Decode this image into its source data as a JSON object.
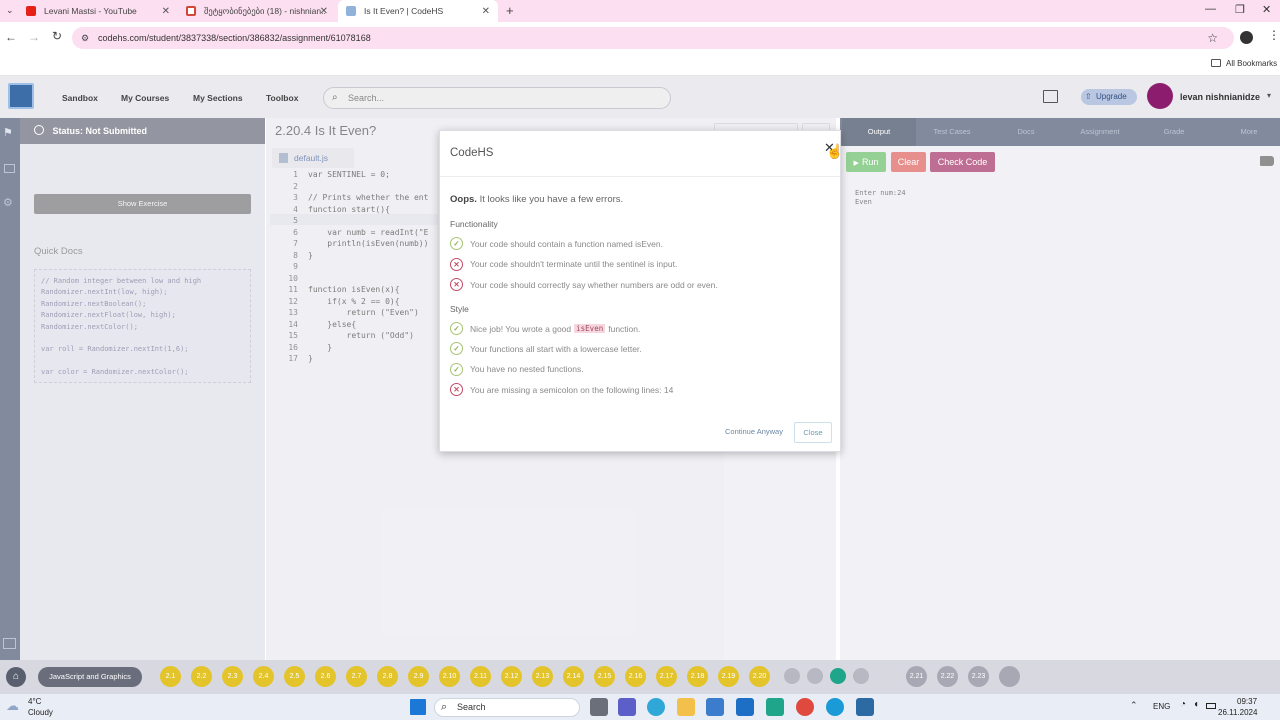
{
  "browser": {
    "tabs": [
      {
        "label": "Levani Mastsi - YouTube",
        "icon": "youtube-icon"
      },
      {
        "label": "შეტყობინებები (18) - nishnian...",
        "icon": "gmail-icon"
      },
      {
        "label": "Is It Even? | CodeHS",
        "icon": "codehs-icon"
      }
    ],
    "url": "codehs.com/student/3837338/section/386832/assignment/61078168",
    "bookmarks_label": "All Bookmarks"
  },
  "nav": {
    "links": [
      "Sandbox",
      "My Courses",
      "My Sections",
      "Toolbox"
    ],
    "search_placeholder": "Search...",
    "upgrade_label": "Upgrade",
    "user_name": "levan nishnianidze"
  },
  "left": {
    "status": "Status: Not Submitted",
    "show_exercise": "Show Exercise",
    "quick_docs_title": "Quick Docs",
    "quick_docs_code": "// Random integer between low and high\nRandomizer.nextInt(low, high);\nRandomizer.nextBoolean();\nRandomizer.nextFloat(low, high);\nRandomizer.nextColor();\n\nvar roll = Randomizer.nextInt(1,6);\n\nvar color = Randomizer.nextColor();"
  },
  "editor": {
    "title": "2.20.4 Is It Even?",
    "file_tab": "default.js",
    "lines": [
      "var SENTINEL = 0;",
      "",
      "// Prints whether the ent",
      "function start(){",
      "",
      "    var numb = readInt(\"E",
      "    println(isEven(numb))",
      "}",
      "",
      "",
      "function isEven(x){",
      "    if(x % 2 == 0){",
      "        return (\"Even\")",
      "    }else{",
      "        return (\"Odd\")",
      "    }",
      "}"
    ]
  },
  "output": {
    "tabs": [
      "Output",
      "Test Cases",
      "Docs",
      "Assignment",
      "Grade",
      "More"
    ],
    "run_label": "Run",
    "clear_label": "Clear",
    "check_label": "Check Code",
    "console_lines": [
      "Enter num:24",
      "Even"
    ]
  },
  "modal": {
    "title": "CodeHS",
    "oops_bold": "Oops.",
    "oops_text": "It looks like you have a few errors.",
    "functionality_label": "Functionality",
    "functionality": [
      {
        "status": "pass",
        "text": "Your code should contain a function named isEven."
      },
      {
        "status": "fail",
        "text": "Your code shouldn't terminate until the sentinel is input."
      },
      {
        "status": "fail",
        "text": "Your code should correctly say whether numbers are odd or even."
      }
    ],
    "style_label": "Style",
    "style_first_pre": "Nice job! You wrote a good",
    "style_first_code": "isEven",
    "style_first_post": "function.",
    "style": [
      {
        "status": "pass",
        "text": "Your functions all start with a lowercase letter."
      },
      {
        "status": "pass",
        "text": "You have no nested functions."
      },
      {
        "status": "fail",
        "text": "You are missing a semicolon on the following lines: 14"
      }
    ],
    "continue_label": "Continue Anyway",
    "close_label": "Close"
  },
  "exercise_bar": {
    "course_label": "JavaScript and Graphics",
    "items": [
      "2.1",
      "2.2",
      "2.3",
      "2.4",
      "2.5",
      "2.6",
      "2.7",
      "2.8",
      "2.9",
      "2.10",
      "2.11",
      "2.12",
      "2.13",
      "2.14",
      "2.15",
      "2.16",
      "2.17",
      "2.18",
      "2.19",
      "2.20"
    ],
    "later_items": [
      "2.21",
      "2.22",
      "2.23"
    ]
  },
  "taskbar": {
    "weather_temp": "4°C",
    "weather_desc": "Cloudy",
    "search_label": "Search",
    "lang": "ENG",
    "time": "09:37",
    "date": "26.11.2024"
  },
  "colors": {
    "accent_nav": "#3e4e69",
    "run_green": "#5cb85c",
    "clear_red": "#d9534f",
    "check_purple": "#9c1f5a",
    "dot_yellow": "#e3c42b"
  }
}
